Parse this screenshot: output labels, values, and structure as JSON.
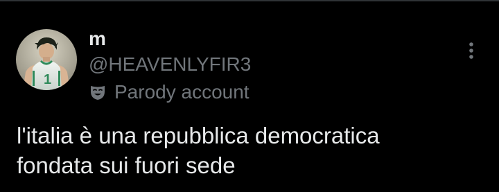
{
  "tweet": {
    "author": {
      "display_name": "m",
      "handle": "@HEAVENLYFIR3",
      "parody_label": "Parody account",
      "parody_icon": "theater-mask-icon",
      "avatar": {
        "description_icon": "profile-avatar",
        "jersey_number": "1",
        "jersey_color": "#eaf2ec",
        "accent_color": "#2f8a5a",
        "hair_color": "#1d2219",
        "background_color": "#b9b5a4"
      }
    },
    "text_lines": [
      "l'italia è una repubblica democratica",
      "fondata sui fuori sede"
    ],
    "more_icon": "more-vertical-icon"
  },
  "colors": {
    "background": "#000000",
    "primary_text": "#e7e9ea",
    "secondary_text": "#71767b",
    "divider": "#2f3336"
  }
}
